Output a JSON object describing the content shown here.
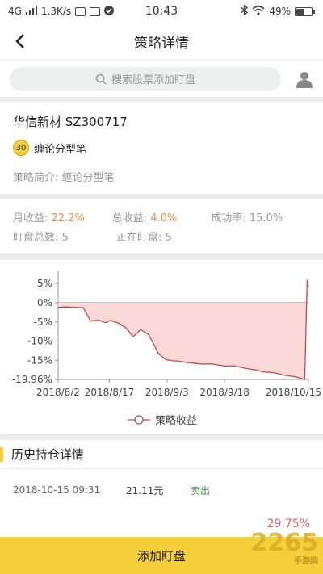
{
  "status_bar": {
    "network": "4G",
    "speed": "1.3K/s",
    "time": "10:43",
    "battery": "49%",
    "battery_level": 0.49
  },
  "nav": {
    "title": "策略详情"
  },
  "search": {
    "placeholder": "搜索股票添加盯盘"
  },
  "stock": {
    "name": "华信新材 SZ300717",
    "badge": "30",
    "strategy": "缠论分型笔",
    "intro": "策略简介: 缠论分型笔"
  },
  "stats": {
    "monthly_label": "月收益: ",
    "monthly_value": "22.2%",
    "total_label": "总收益: ",
    "total_value": "4.0%",
    "success": "成功率: 15.0%",
    "watch_total": "盯盘总数: 5",
    "watching": "正在盯盘: 5"
  },
  "chart_data": {
    "type": "area",
    "y_ticks": [
      "5%",
      "0%",
      "-5%",
      "-10%",
      "-15%",
      "-19.96%"
    ],
    "y_tick_values": [
      5,
      0,
      -5,
      -10,
      -15,
      -19.96
    ],
    "x_ticks": [
      "2018/8/2",
      "2018/8/17",
      "2018/9/3",
      "2018/9/18",
      "2018/10/15"
    ],
    "x_tick_pos": [
      0,
      0.205,
      0.435,
      0.665,
      1.0
    ],
    "ylim": [
      -19.96,
      6.5
    ],
    "series": [
      {
        "name": "策略收益",
        "x": [
          0,
          0.03,
          0.1,
          0.13,
          0.16,
          0.19,
          0.21,
          0.24,
          0.27,
          0.3,
          0.33,
          0.36,
          0.38,
          0.4,
          0.43,
          0.46,
          0.49,
          0.52,
          0.55,
          0.58,
          0.61,
          0.64,
          0.67,
          0.7,
          0.73,
          0.76,
          0.79,
          0.82,
          0.86,
          0.9,
          0.95,
          0.985,
          0.995,
          1.0
        ],
        "y": [
          -1.2,
          -1.1,
          -1.3,
          -4.8,
          -4.5,
          -5.2,
          -4.6,
          -5.3,
          -6.5,
          -8.8,
          -7.0,
          -8.2,
          -10.5,
          -13.2,
          -14.8,
          -15.1,
          -15.3,
          -15.6,
          -15.8,
          -16.0,
          -15.9,
          -16.2,
          -16.5,
          -16.4,
          -16.8,
          -17.2,
          -17.5,
          -18.0,
          -18.2,
          -18.8,
          -19.3,
          -19.96,
          6.0,
          4.0
        ]
      }
    ],
    "legend": "bottom"
  },
  "history": {
    "title": "历史持仓详情",
    "rows": [
      {
        "time": "2018-10-15 09:31",
        "price": "21.11元",
        "action": "卖出"
      }
    ],
    "return": "29.75%"
  },
  "bottom": {
    "label": "添加盯盘"
  },
  "watermark": {
    "brand": "2265",
    "site": "手游网"
  },
  "colors": {
    "accent": "#f5cf3a",
    "line": "#c44a4a",
    "area": "#fbd9d9",
    "green": "#3a9a3a"
  }
}
